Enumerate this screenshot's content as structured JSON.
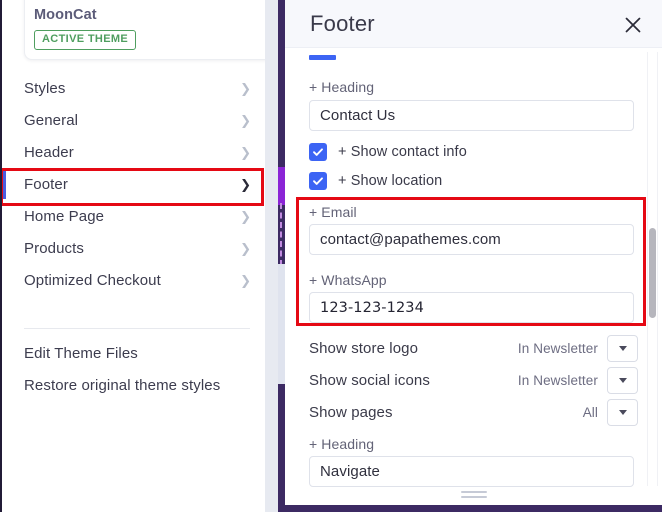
{
  "sidebar": {
    "theme": {
      "name": "MoonCat",
      "badge": "ACTIVE THEME"
    },
    "nav_items": [
      {
        "label": "Styles",
        "chevron": "chevron-right-icon",
        "active": false
      },
      {
        "label": "General",
        "chevron": "chevron-right-icon",
        "active": false
      },
      {
        "label": "Header",
        "chevron": "chevron-right-icon",
        "active": false
      },
      {
        "label": "Footer",
        "chevron": "chevron-right-icon",
        "active": true
      },
      {
        "label": "Home Page",
        "chevron": "chevron-right-icon",
        "active": false
      },
      {
        "label": "Products",
        "chevron": "chevron-right-icon",
        "active": false
      },
      {
        "label": "Optimized Checkout",
        "chevron": "chevron-right-icon",
        "active": false
      }
    ],
    "links": [
      {
        "label": "Edit Theme Files"
      },
      {
        "label": "Restore original theme styles"
      }
    ]
  },
  "panel": {
    "title": "Footer",
    "close_icon": "close-icon",
    "fields": {
      "heading_label": "+ Heading",
      "heading_value": "Contact Us",
      "show_contact_info_label": "+ Show contact info",
      "show_contact_info_checked": true,
      "show_location_label": "+ Show location",
      "show_location_checked": true,
      "email_label": "+ Email",
      "email_value": "contact@papathemes.com",
      "whatsapp_label": "+ WhatsApp",
      "whatsapp_value": "123-123-1234",
      "nav_heading_label": "+ Heading",
      "nav_heading_value": "Navigate"
    },
    "selects": [
      {
        "name": "Show store logo",
        "value": "In Newsletter"
      },
      {
        "name": "Show social icons",
        "value": "In Newsletter"
      },
      {
        "name": "Show pages",
        "value": "All"
      }
    ]
  },
  "colors": {
    "accent_blue": "#3c64f4",
    "rail_purple": "#3c2a63",
    "annotation_red": "#e50914",
    "badge_green": "#4f9e5f"
  }
}
